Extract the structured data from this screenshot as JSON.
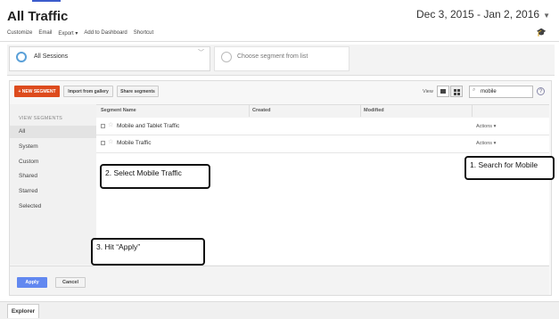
{
  "page": {
    "title": "All Traffic",
    "date_range": "Dec 3, 2015 - Jan 2, 2016"
  },
  "toolbar": {
    "customize": "Customize",
    "email": "Email",
    "export": "Export",
    "add_to_dashboard": "Add to Dashboard",
    "shortcut": "Shortcut"
  },
  "segments": {
    "active": "All Sessions",
    "placeholder": "Choose segment from list"
  },
  "panel": {
    "new_segment": "+ NEW SEGMENT",
    "import_gallery": "Import from gallery",
    "share_segments": "Share segments",
    "view_label": "View",
    "search_value": "mobile",
    "help": "?"
  },
  "sidebar": {
    "heading": "VIEW SEGMENTS",
    "items": [
      {
        "label": "All"
      },
      {
        "label": "System"
      },
      {
        "label": "Custom"
      },
      {
        "label": "Shared"
      },
      {
        "label": "Starred"
      },
      {
        "label": "Selected"
      }
    ]
  },
  "table": {
    "columns": [
      "Segment Name",
      "Created",
      "Modified"
    ],
    "rows": [
      {
        "name": "Mobile and Tablet Traffic",
        "actions": "Actions"
      },
      {
        "name": "Mobile Traffic",
        "actions": "Actions"
      }
    ]
  },
  "callouts": {
    "step1": "1. Search for Mobile",
    "step2": "2. Select Mobile Traffic",
    "step3": "3. Hit “Apply”"
  },
  "footer": {
    "apply": "Apply",
    "cancel": "Cancel"
  },
  "bottom": {
    "explorer_tab": "Explorer"
  },
  "colors": {
    "accent_new": "#dd4b1d",
    "accent_apply": "#6288f0",
    "segment_ring": "#5aa0d8"
  }
}
